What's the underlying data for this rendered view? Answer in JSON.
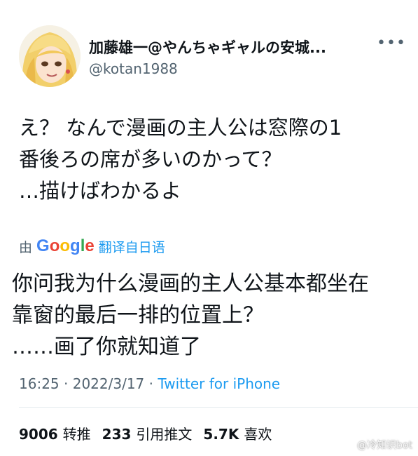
{
  "author": {
    "display_name": "加藤雄一@やんちゃギャルの安城...",
    "handle": "@kotan1988"
  },
  "more_icon": "more-horizontal-icon",
  "tweet": {
    "text": "え？ なんで漫画の主人公は窓際の1\n番後ろの席が多いのかって？\n…描けばわかるよ"
  },
  "translation": {
    "by_label": "由",
    "google_label": "Google",
    "translate_label": "翻译自日语",
    "text": "你问我为什么漫画的主人公基本都坐在\n靠窗的最后一排的位置上？\n……画了你就知道了"
  },
  "meta": {
    "time": "16:25",
    "separator": " · ",
    "date": "2022/3/17",
    "source": "Twitter for iPhone"
  },
  "stats": {
    "retweets_count": "9006",
    "retweets_label": "转推",
    "quotes_count": "233",
    "quotes_label": "引用推文",
    "likes_count": "5.7K",
    "likes_label": "喜欢"
  },
  "watermark": {
    "text": "@冷知识bot"
  },
  "colors": {
    "link": "#1d9bf0",
    "secondary_text": "#536471",
    "primary_text": "#0f1419"
  }
}
